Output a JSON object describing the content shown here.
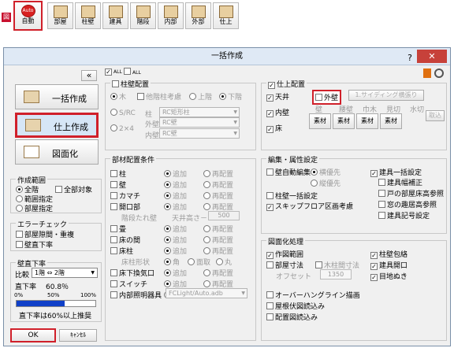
{
  "toolbar": {
    "zu": "図",
    "auto_logo": "Auto",
    "buttons": [
      "自動",
      "部屋",
      "柱壁",
      "建具",
      "階段",
      "内部",
      "外部",
      "仕上"
    ]
  },
  "dialog": {
    "title": "一括作成",
    "help": "?",
    "close": "✕",
    "collapse": "«",
    "icons": {
      "all_on": "ALL",
      "all_off": "ALL"
    },
    "left": {
      "btn_bulk": "一括作成",
      "btn_finish": "仕上作成",
      "btn_draw": "図面化",
      "range": {
        "title": "作成範囲",
        "all_floors": "全階",
        "all_target": "全部対象",
        "range_spec": "範囲指定",
        "room_spec": "部屋指定"
      },
      "error": {
        "title": "エラーチェック",
        "gap": "部屋隙間・重複",
        "wall_direct": "壁直下率"
      },
      "direct": {
        "title": "壁直下率",
        "ratio_label": "比較",
        "ratio_value": "1階 ⇔ 2階",
        "rate_label": "直下率",
        "rate_value": "60.8％",
        "ticks": [
          "0%",
          "50%",
          "100%"
        ],
        "progress": 0.608,
        "note": "直下率は60%以上推奨"
      },
      "ok": "OK",
      "cancel": "ｷｬﾝｾﾙ"
    },
    "pillar": {
      "title": "柱壁配置",
      "wood": "木",
      "consider_other": "他階柱考慮",
      "up": "上階",
      "down": "下階",
      "src": "S/RC",
      "pillar_lbl": "柱",
      "pillar_val": "RC矩形柱",
      "two_by": "2×4",
      "ext_wall_lbl": "外壁",
      "ext_wall_val": "RC壁",
      "int_wall_lbl": "内壁",
      "int_wall_val": "RC壁"
    },
    "parts": {
      "title": "部材配置条件",
      "rows": [
        {
          "name": "柱",
          "ext": false
        },
        {
          "name": "壁",
          "ext": false
        },
        {
          "name": "カマチ",
          "ext": true
        },
        {
          "name": "開口部",
          "ext": true
        },
        {
          "name": "畳",
          "ext": false
        },
        {
          "name": "床の間",
          "ext": false
        },
        {
          "name": "床柱",
          "ext": false
        },
        {
          "name": "床下換気口",
          "ext": false
        },
        {
          "name": "スイッチ",
          "ext": false
        },
        {
          "name": "内部照明器具",
          "ext": true
        }
      ],
      "add": "追加",
      "replace": "再配置",
      "hang": "階段たれ壁",
      "ceil_h": "天井高さ－",
      "ceil_val": "500",
      "style": "床柱形状",
      "sq": "角",
      "chamfer": "面取",
      "round": "丸",
      "light_val": "FCLight/Auto.adb"
    },
    "finish": {
      "title": "仕上配置",
      "ceiling": "天井",
      "exterior": "外壁",
      "ext_btn": "1.サイディング横張り",
      "interior": "内壁",
      "floor": "床",
      "cols": [
        "壁",
        "腰壁",
        "巾木",
        "見切",
        "水切"
      ],
      "mat": "素材",
      "remove": "取込"
    },
    "edit": {
      "title": "編集・属性設定",
      "wall_auto": "壁自動編集",
      "horiz": "横優先",
      "vert": "縦優先",
      "pillar_wall": "柱壁一括設定",
      "skip": "スキップフロア区画考慮",
      "fittings": "建具一括設定",
      "fit_width": "建具幅補正",
      "door_floor": "戸の部屋床高参照",
      "window_floor": "窓の趣居高参照",
      "fit_sign": "建具記号設定"
    },
    "draw": {
      "title": "図面化処理",
      "area": "作図範囲",
      "col_note": "柱壁包絡",
      "room_dim": "部屋寸法",
      "wood_dim": "木柱間寸法",
      "opening": "建具開口",
      "offset": "オフセット",
      "offset_val": "1350",
      "joint": "目地ぬき",
      "overhang": "オーバーハングライン描画",
      "roof": "屋根伏図読込み",
      "layout": "配置図読込み"
    }
  }
}
